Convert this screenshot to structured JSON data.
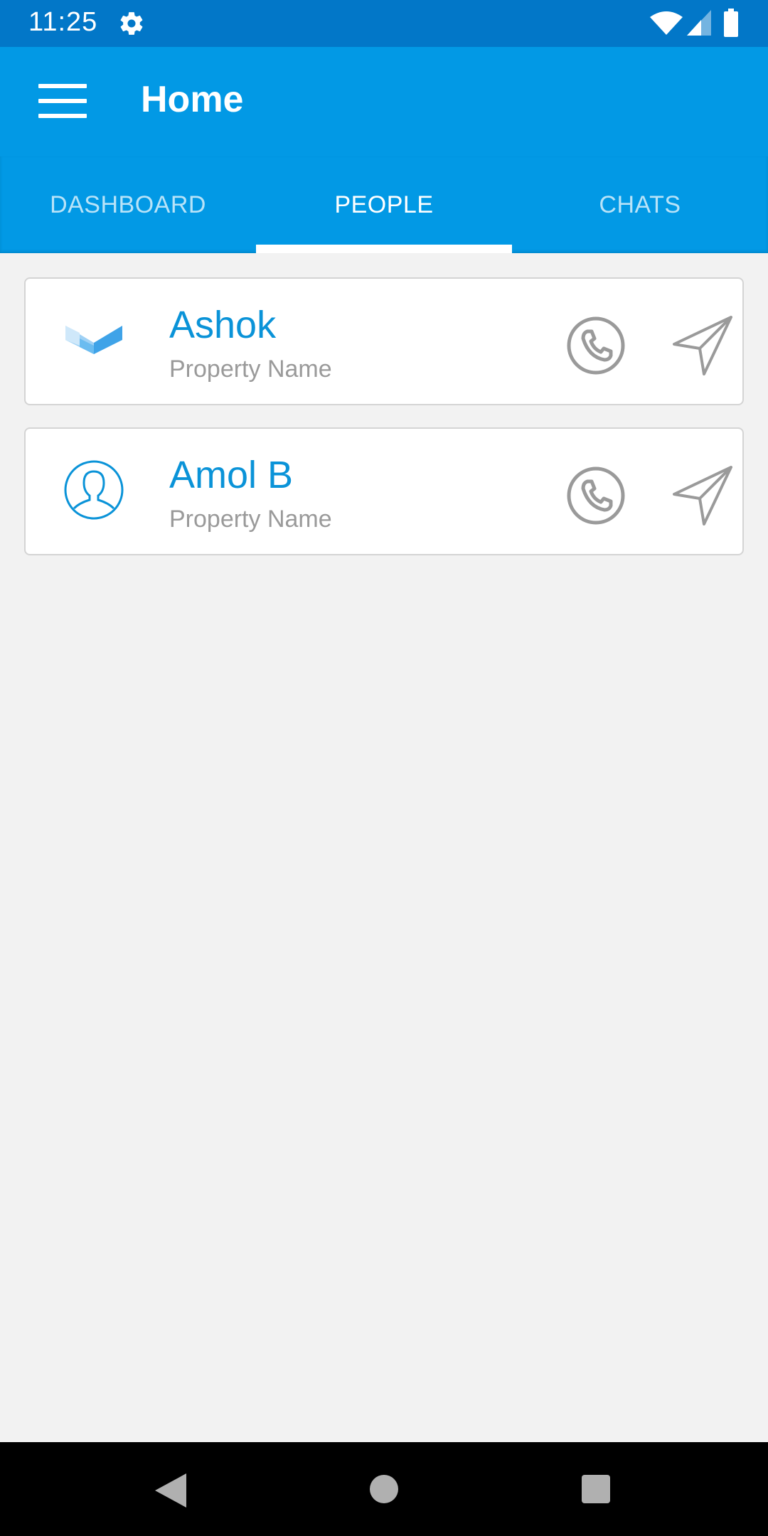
{
  "status_bar": {
    "time": "11:25",
    "icons": [
      "gear-icon",
      "wifi-icon",
      "signal-icon",
      "battery-icon"
    ]
  },
  "app_bar": {
    "title": "Home",
    "menu_icon": "hamburger-menu-icon"
  },
  "tabs": [
    {
      "label": "DASHBOARD",
      "active": false
    },
    {
      "label": "PEOPLE",
      "active": true
    },
    {
      "label": "CHATS",
      "active": false
    }
  ],
  "people": [
    {
      "name": "Ashok",
      "subtitle": "Property Name",
      "avatar": "company-logo-icon"
    },
    {
      "name": "Amol B",
      "subtitle": "Property Name",
      "avatar": "user-avatar-icon"
    }
  ],
  "colors": {
    "status_bar": "#0277c8",
    "primary": "#0299e5",
    "name_text": "#0a93d8",
    "subtitle_text": "#9a9a9a",
    "background": "#f2f2f2"
  },
  "nav_bar": {
    "icons": [
      "back-icon",
      "home-icon",
      "recents-icon"
    ]
  }
}
